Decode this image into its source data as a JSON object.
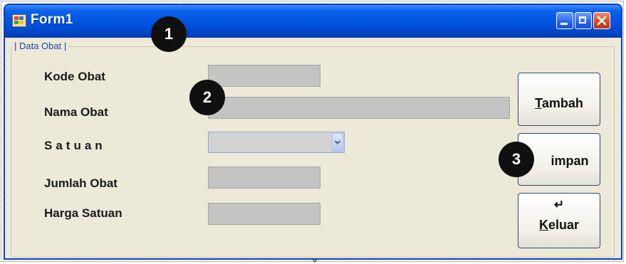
{
  "window": {
    "title": "Form1"
  },
  "groupbox": {
    "legend": "| Data Obat |"
  },
  "fields": {
    "kode_obat": {
      "label": "Kode Obat",
      "value": ""
    },
    "nama_obat": {
      "label": "Nama Obat",
      "value": ""
    },
    "satuan": {
      "label": "Satuan",
      "selected": ""
    },
    "jumlah_obat": {
      "label": "Jumlah Obat",
      "value": ""
    },
    "harga_satuan": {
      "label": "Harga Satuan",
      "value": ""
    }
  },
  "buttons": {
    "tambah": {
      "mnemonic": "T",
      "rest": "ambah"
    },
    "simpan": {
      "visible_text": "impan"
    },
    "keluar": {
      "icon": "enter-arrow-icon",
      "glyph": "↵",
      "mnemonic": "K",
      "rest": "eluar"
    }
  },
  "callouts": [
    "1",
    "2",
    "3"
  ],
  "colors": {
    "titlebar": "#0052e0",
    "form_background": "#ece9d8",
    "textbox_fill": "#c4c4c4",
    "callout_fill": "#101010"
  }
}
